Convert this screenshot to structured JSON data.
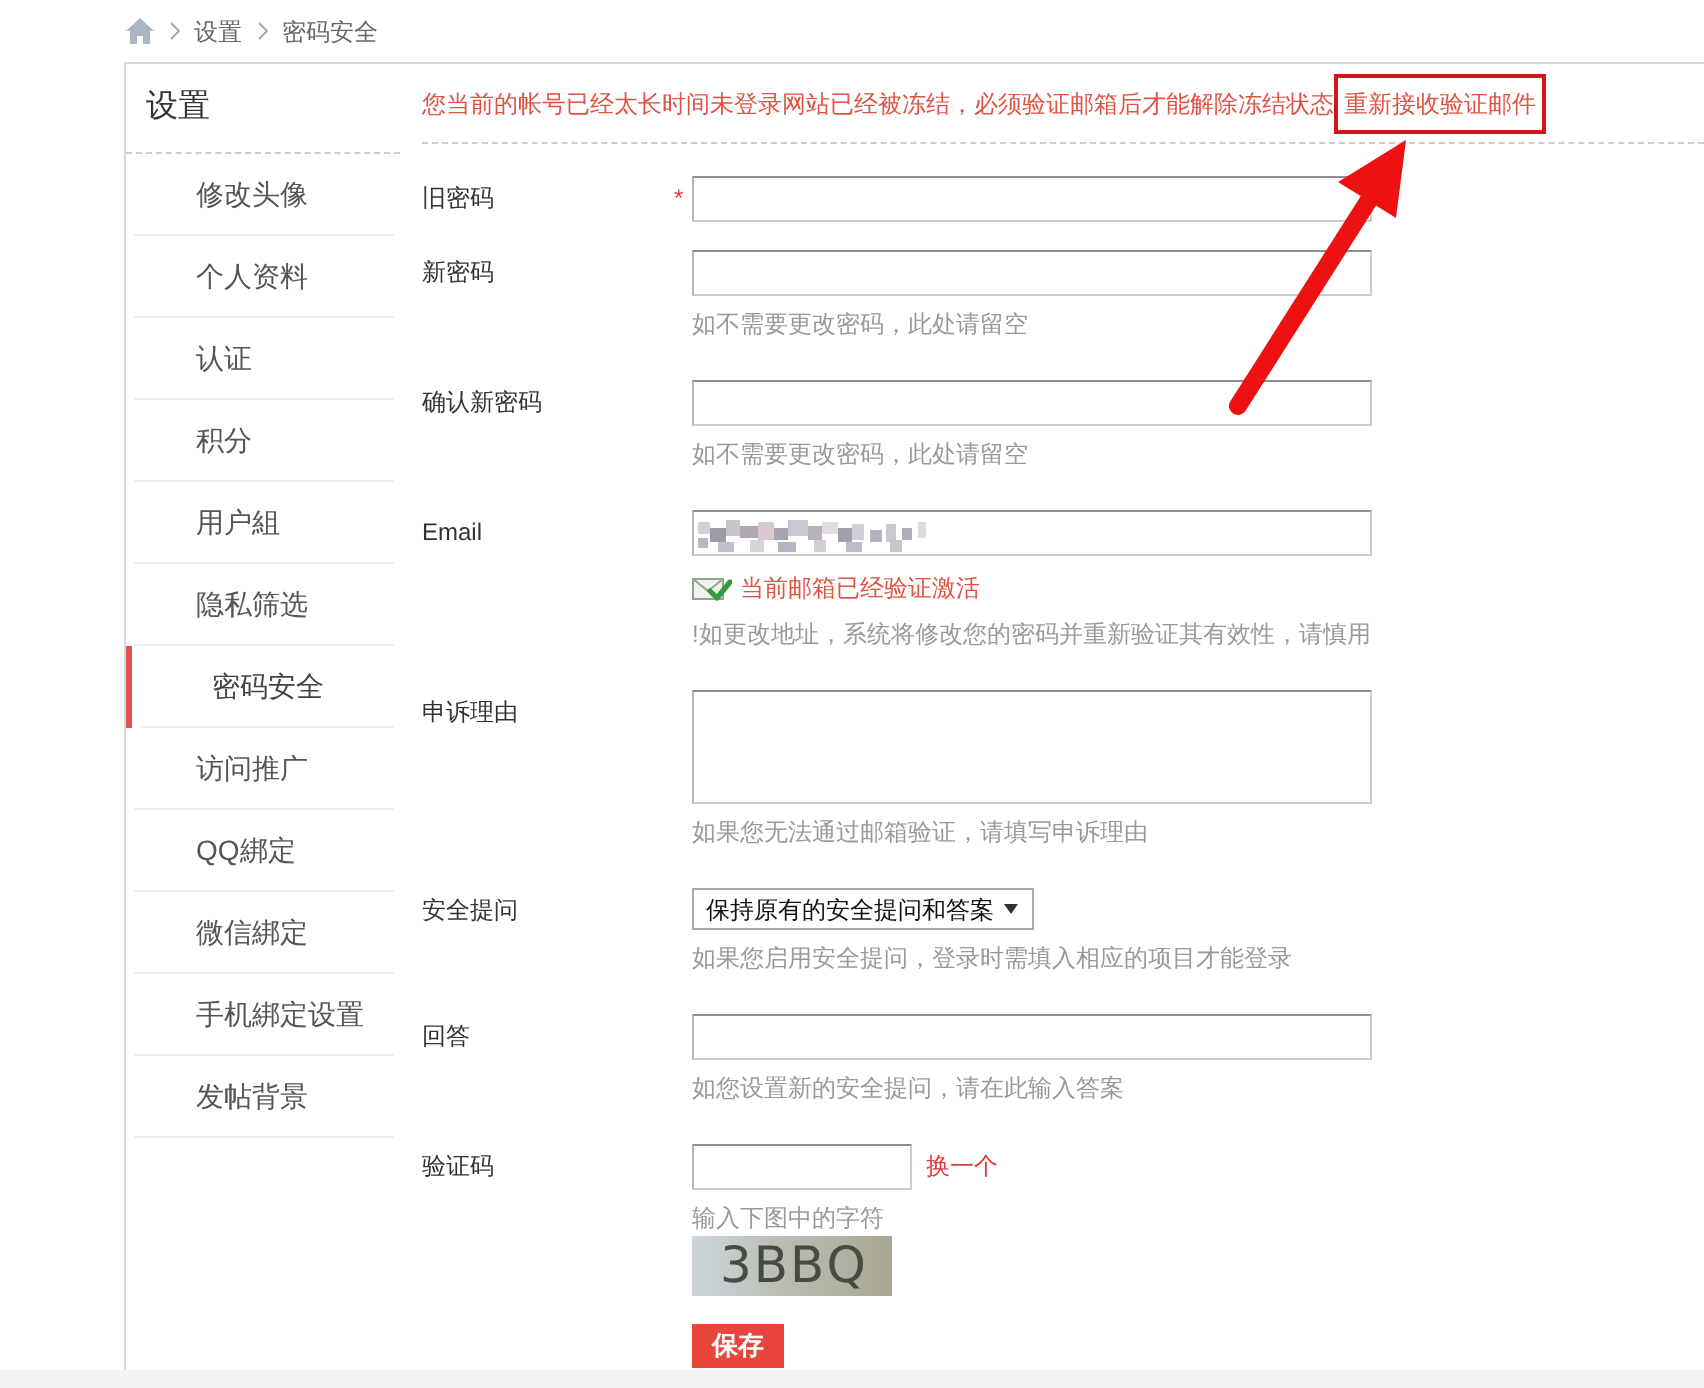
{
  "breadcrumb": [
    {
      "label": "设置"
    },
    {
      "label": "密码安全"
    }
  ],
  "sidebar": {
    "title": "设置",
    "items": [
      {
        "label": "修改头像",
        "selected": false
      },
      {
        "label": "个人资料",
        "selected": false
      },
      {
        "label": "认证",
        "selected": false
      },
      {
        "label": "积分",
        "selected": false
      },
      {
        "label": "用户組",
        "selected": false
      },
      {
        "label": "隐私筛选",
        "selected": false
      },
      {
        "label": "密码安全",
        "selected": true
      },
      {
        "label": "访问推广",
        "selected": false
      },
      {
        "label": "QQ綁定",
        "selected": false
      },
      {
        "label": "微信綁定",
        "selected": false
      },
      {
        "label": "手机綁定设置",
        "selected": false
      },
      {
        "label": "发帖背景",
        "selected": false
      }
    ]
  },
  "notice": {
    "text": "您当前的帐号已经太长时间未登录网站已经被冻结，必须验证邮箱后才能解除冻结状态",
    "link": "重新接收验证邮件"
  },
  "fields": [
    {
      "kind": "password",
      "label": "旧密码",
      "required_mark": "*"
    },
    {
      "kind": "password",
      "label": "新密码",
      "hint": "如不需要更改密码，此处请留空"
    },
    {
      "kind": "password",
      "label": "确认新密码",
      "hint": "如不需要更改密码，此处请留空"
    },
    {
      "kind": "email",
      "label": "Email",
      "value_blurred": true,
      "status": "当前邮箱已经验证激活",
      "hint": "!如更改地址，系统将修改您的密码并重新验证其有效性，请慎用"
    },
    {
      "kind": "textarea",
      "label": "申诉理由",
      "hint": "如果您无法通过邮箱验证，请填写申诉理由"
    },
    {
      "kind": "select",
      "label": "安全提问",
      "value": "保持原有的安全提问和答案",
      "hint": "如果您启用安全提问，登录时需填入相应的项目才能登录"
    },
    {
      "kind": "text",
      "label": "回答",
      "hint": "如您设置新的安全提问，请在此输入答案"
    },
    {
      "kind": "captcha",
      "label": "验证码",
      "refresh": "换一个",
      "hint": "输入下图中的字符",
      "captcha_text": "3BBQ"
    }
  ],
  "save_button": "保存"
}
